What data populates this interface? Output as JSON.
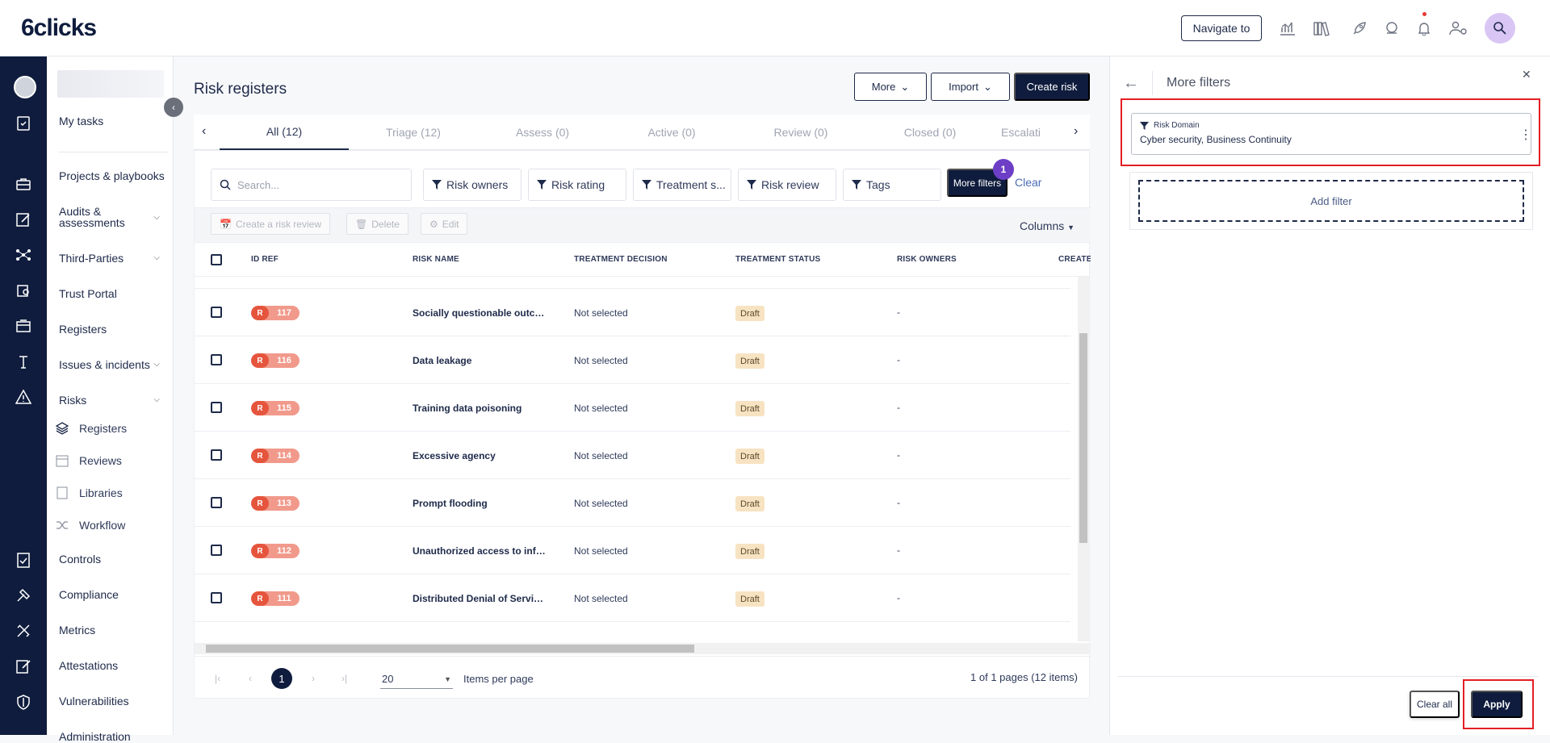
{
  "header": {
    "logo": "6clicks",
    "navigate_label": "Navigate to",
    "icons": [
      "analytics-icon",
      "library-icon",
      "rocket-icon",
      "support-icon",
      "bell-icon",
      "users-settings-icon",
      "ai-search-icon"
    ]
  },
  "sidebar": {
    "my_tasks": "My tasks",
    "items": [
      {
        "label": "Projects & playbooks"
      },
      {
        "label": "Audits & assessments"
      },
      {
        "label": "Third-Parties"
      },
      {
        "label": "Trust Portal"
      },
      {
        "label": "Registers"
      },
      {
        "label": "Issues & incidents"
      },
      {
        "label": "Risks"
      },
      {
        "label": "Controls"
      },
      {
        "label": "Compliance"
      },
      {
        "label": "Metrics"
      },
      {
        "label": "Attestations"
      },
      {
        "label": "Vulnerabilities"
      },
      {
        "label": "Administration"
      }
    ],
    "risk_subitems": [
      {
        "label": "Registers",
        "icon": "layers-icon"
      },
      {
        "label": "Reviews",
        "icon": "calendar-icon"
      },
      {
        "label": "Libraries",
        "icon": "book-icon"
      },
      {
        "label": "Workflow",
        "icon": "shuffle-icon"
      }
    ]
  },
  "page": {
    "title": "Risk registers",
    "more_label": "More",
    "import_label": "Import",
    "create_label": "Create risk",
    "tabs": [
      {
        "label": "All (12)",
        "active": true
      },
      {
        "label": "Triage (12)"
      },
      {
        "label": "Assess (0)"
      },
      {
        "label": "Active (0)"
      },
      {
        "label": "Review (0)"
      },
      {
        "label": "Closed (0)"
      },
      {
        "label": "Escalati"
      }
    ],
    "search_placeholder": "Search...",
    "filters": [
      "Risk owners",
      "Risk rating",
      "Treatment s...",
      "Risk review",
      "Tags"
    ],
    "more_filters_label": "More filters",
    "more_filters_count": "1",
    "clear_label": "Clear",
    "actions": [
      "Create a risk review",
      "Delete",
      "Edit"
    ],
    "columns_label": "Columns",
    "table_headers": [
      "ID REF",
      "RISK NAME",
      "TREATMENT DECISION",
      "TREATMENT STATUS",
      "RISK OWNERS",
      "CREATED"
    ],
    "rows": [
      {
        "prefix": "R",
        "id": "117",
        "name": "Socially questionable outco...",
        "decision": "Not selected",
        "status": "Draft",
        "owners": "-"
      },
      {
        "prefix": "R",
        "id": "116",
        "name": "Data leakage",
        "decision": "Not selected",
        "status": "Draft",
        "owners": "-"
      },
      {
        "prefix": "R",
        "id": "115",
        "name": "Training data poisoning",
        "decision": "Not selected",
        "status": "Draft",
        "owners": "-"
      },
      {
        "prefix": "R",
        "id": "114",
        "name": "Excessive agency",
        "decision": "Not selected",
        "status": "Draft",
        "owners": "-"
      },
      {
        "prefix": "R",
        "id": "113",
        "name": "Prompt flooding",
        "decision": "Not selected",
        "status": "Draft",
        "owners": "-"
      },
      {
        "prefix": "R",
        "id": "112",
        "name": "Unauthorized access to infr...",
        "decision": "Not selected",
        "status": "Draft",
        "owners": "-"
      },
      {
        "prefix": "R",
        "id": "111",
        "name": "Distributed Denial of Servic...",
        "decision": "Not selected",
        "status": "Draft",
        "owners": "-"
      }
    ],
    "pagination": {
      "current": "1",
      "page_size": "20",
      "page_size_label": "Items per page",
      "info": "1 of 1 pages (12 items)"
    }
  },
  "filter_panel": {
    "title": "More filters",
    "chip_label": "Risk Domain",
    "chip_value": "Cyber security, Business Continuity",
    "add_filter_label": "Add filter",
    "clear_all_label": "Clear all",
    "apply_label": "Apply"
  }
}
